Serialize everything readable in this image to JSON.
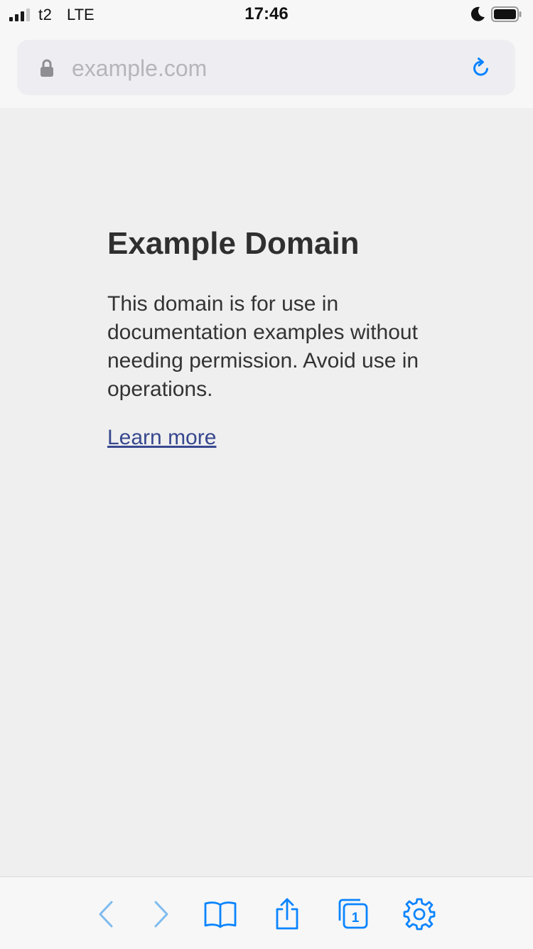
{
  "status_bar": {
    "carrier": "t2",
    "network": "LTE",
    "time": "17:46"
  },
  "address_bar": {
    "url": "example.com",
    "lock_icon": "lock-icon",
    "reload_icon": "reload-icon"
  },
  "page": {
    "heading": "Example Domain",
    "body": "This domain is for use in documentation examples without needing permission. Avoid use in operations.",
    "link_label": "Learn more"
  },
  "toolbar": {
    "items": [
      {
        "name": "back-button",
        "icon": "chevron-left-icon"
      },
      {
        "name": "forward-button",
        "icon": "chevron-right-icon"
      },
      {
        "name": "bookmarks-button",
        "icon": "book-icon"
      },
      {
        "name": "share-button",
        "icon": "share-icon"
      },
      {
        "name": "tabs-button",
        "icon": "tabs-icon",
        "label": "1"
      },
      {
        "name": "settings-button",
        "icon": "gear-icon"
      }
    ]
  },
  "colors": {
    "accent": "#0a84ff",
    "link": "#38488f",
    "page_background": "#efefef",
    "chrome_background": "#f7f7f7"
  }
}
